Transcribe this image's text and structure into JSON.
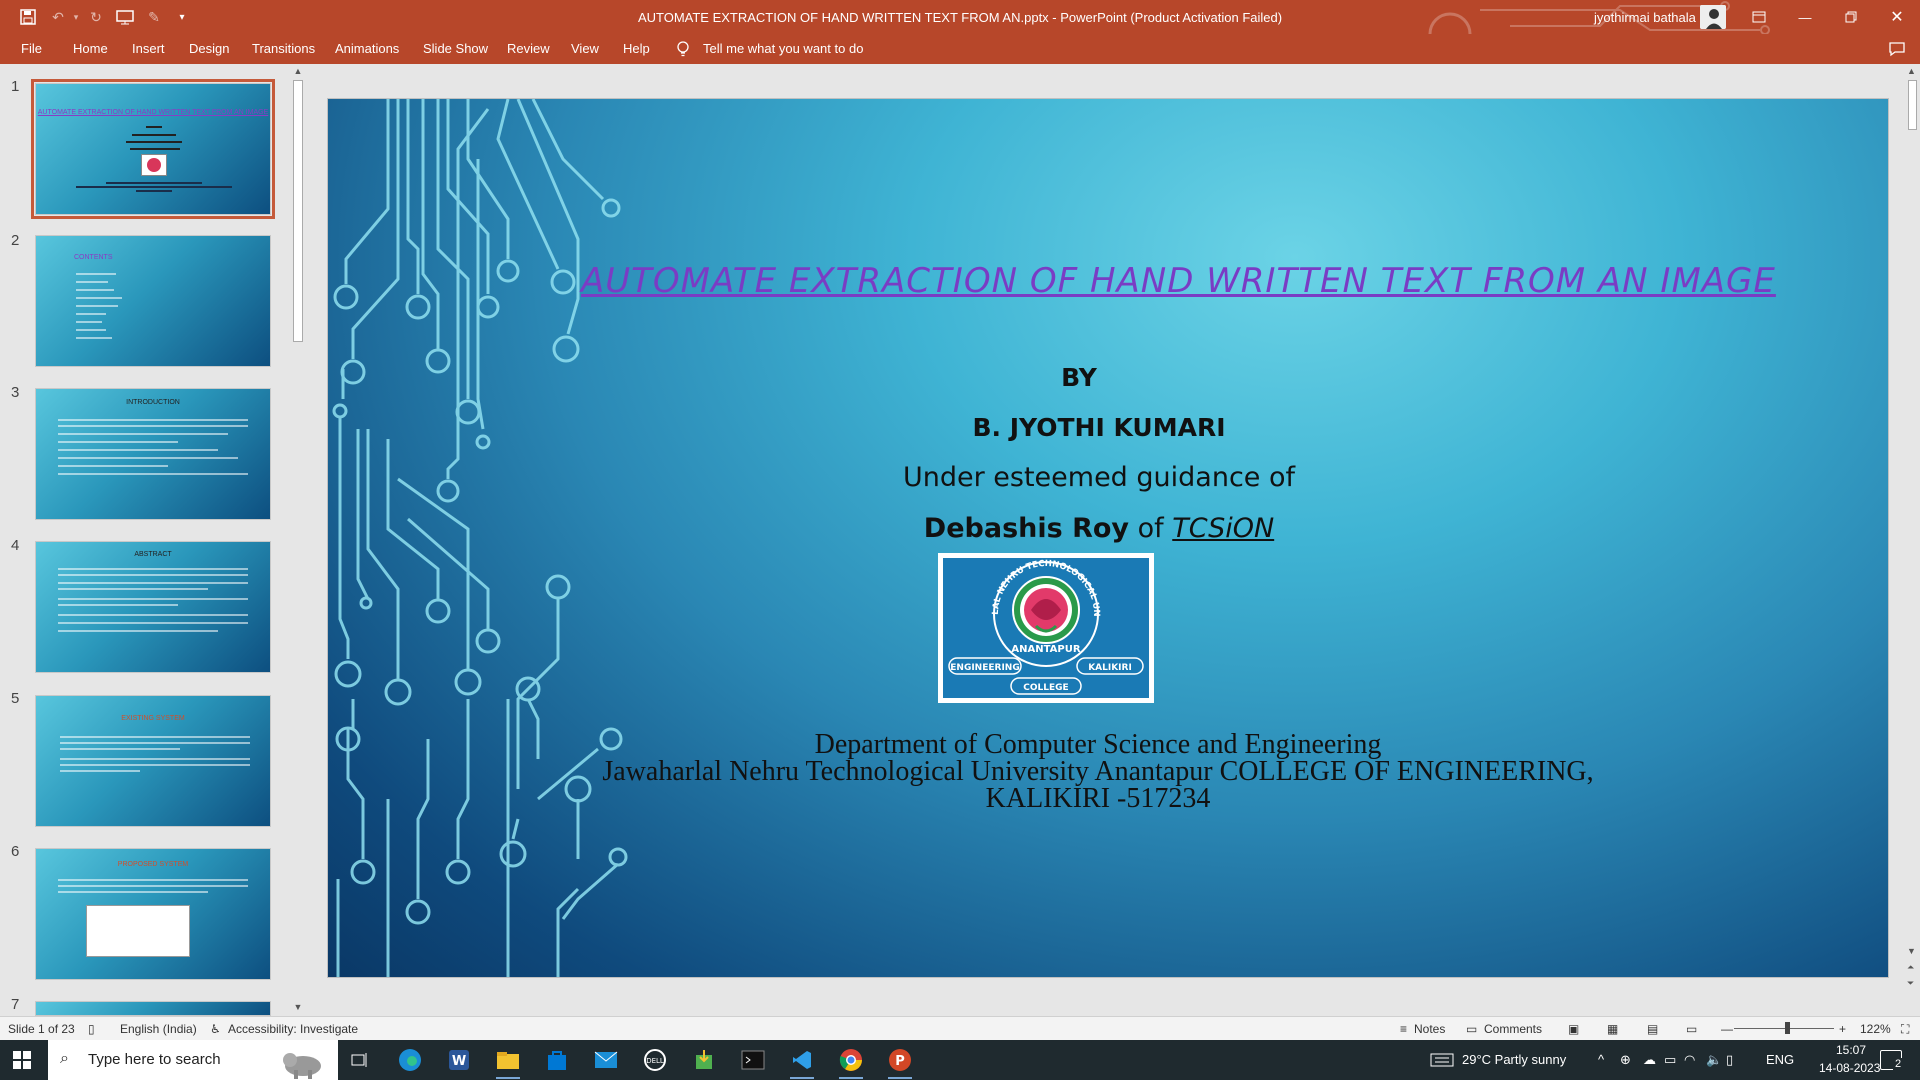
{
  "app": {
    "title": "AUTOMATE EXTRACTION OF HAND WRITTEN TEXT FROM AN.pptx  -  PowerPoint (Product Activation Failed)",
    "user": "jyothirmai bathala",
    "colors": {
      "accent": "#b7472a",
      "slide_title": "#7a3cc4",
      "selected_thumb_border": "#c55a3a"
    }
  },
  "quick_access": {
    "icons": [
      "save-icon",
      "undo-icon",
      "redo-icon",
      "present-icon",
      "touch-mode-icon",
      "customize-icon"
    ]
  },
  "ribbon": {
    "tabs": [
      "File",
      "Home",
      "Insert",
      "Design",
      "Transitions",
      "Animations",
      "Slide Show",
      "Review",
      "View",
      "Help"
    ],
    "tell_me": "Tell me what you want to do"
  },
  "thumbnails": {
    "numbers": [
      "1",
      "2",
      "3",
      "4",
      "5",
      "6",
      "7"
    ],
    "titles": [
      "AUTOMATE EXTRACTION OF HAND WRITTEN TEXT FROM AN IMAGE",
      "CONTENTS",
      "INTRODUCTION",
      "ABSTRACT",
      "EXISTING SYSTEM",
      "PROPOSED SYSTEM"
    ]
  },
  "slide": {
    "title": "AUTOMATE EXTRACTION OF HAND WRITTEN TEXT FROM AN IMAGE",
    "by": "BY",
    "author": "B. JYOTHI KUMARI",
    "guidance": "Under esteemed guidance of",
    "guide_name": "Debashis Roy",
    "guide_of": "of",
    "guide_org": "TCSiON",
    "logo_top": "JAWAHARLAL NEHRU TECHNOLOGICAL UNIVERSITY",
    "logo_city": "ANANTAPUR",
    "logo_left": "ENGINEERING",
    "logo_right": "KALIKIRI",
    "logo_bottom": "COLLEGE",
    "dept": "Department of Computer Science and Engineering",
    "college": "Jawaharlal Nehru Technological University Anantapur COLLEGE OF ENGINEERING,",
    "place": "KALIKIRI -517234"
  },
  "status": {
    "slide_info": "Slide 1 of 23",
    "language": "English (India)",
    "accessibility": "Accessibility: Investigate",
    "notes": "Notes",
    "comments": "Comments",
    "zoom": "122%"
  },
  "taskbar": {
    "search_placeholder": "Type here to search",
    "weather": "29°C  Partly sunny",
    "lang": "ENG",
    "time": "15:07",
    "date": "14-08-2023",
    "notification_count": "2"
  }
}
